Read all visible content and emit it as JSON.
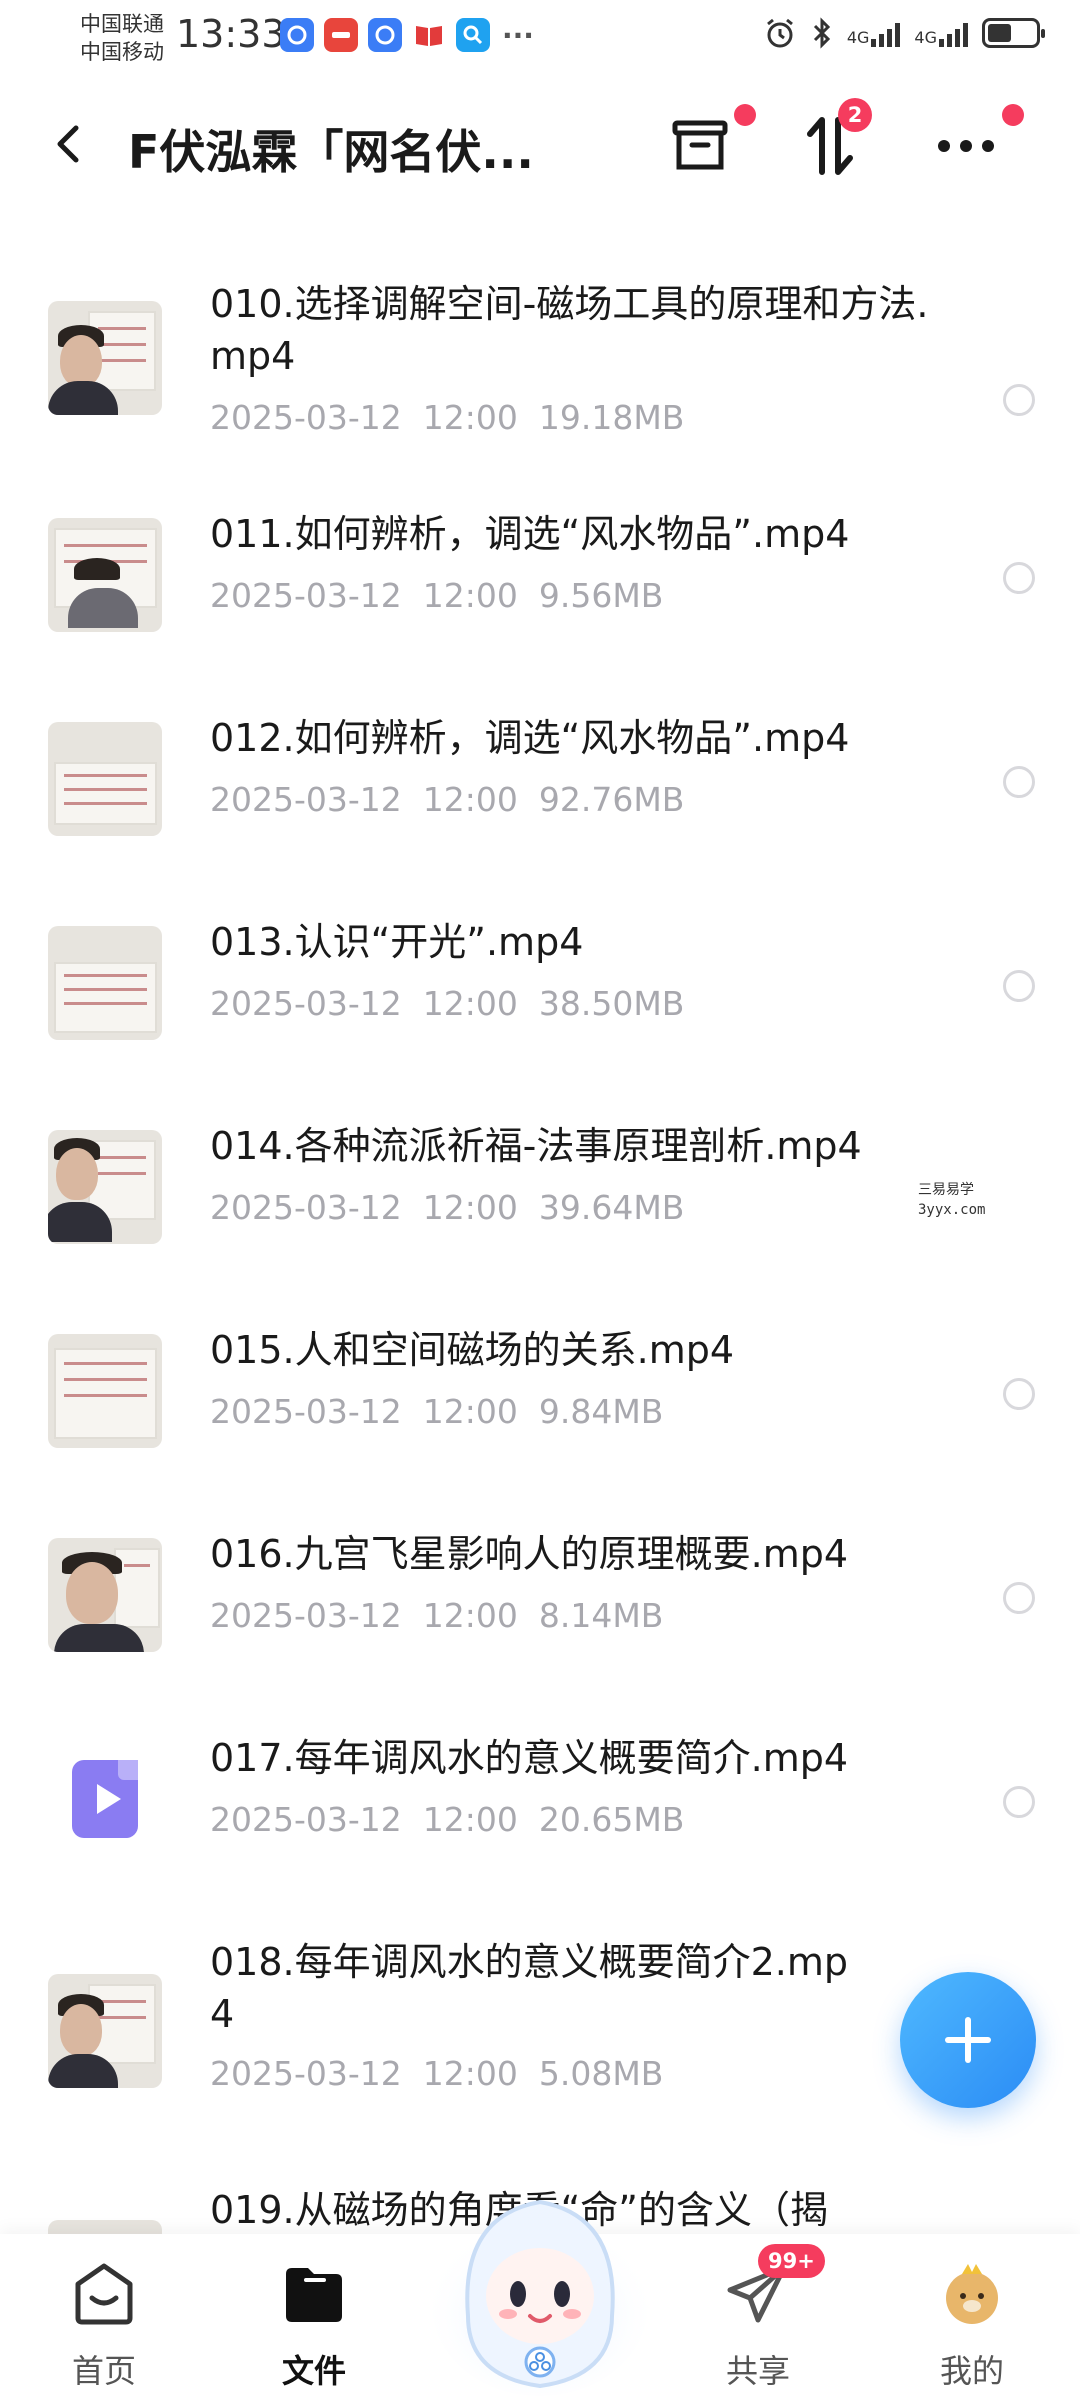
{
  "status_bar": {
    "carrier_1": "中国联通",
    "carrier_2": "中国移动",
    "time": "13:33",
    "notification_icons": [
      "baidu-netdisk-icon",
      "huawei-store-icon",
      "baidu-netdisk-icon",
      "book-reader-icon",
      "search-app-icon"
    ],
    "more_notifications": "···",
    "sim1_network": "4G",
    "sim2_network": "4G"
  },
  "header": {
    "title": "F伏泓霖「网名伏...",
    "transfer_badge": "2"
  },
  "files": [
    {
      "name": "010.选择调解空间-磁场工具的原理和方法.mp4",
      "date": "2025-03-12",
      "time": "12:00",
      "size": "19.18MB",
      "thumb": "photo"
    },
    {
      "name": "011.如何辨析，调选“风水物品”.mp4",
      "date": "2025-03-12",
      "time": "12:00",
      "size": "9.56MB",
      "thumb": "photo"
    },
    {
      "name": "012.如何辨析，调选“风水物品”.mp4",
      "date": "2025-03-12",
      "time": "12:00",
      "size": "92.76MB",
      "thumb": "photo"
    },
    {
      "name": "013.认识“开光”.mp4",
      "date": "2025-03-12",
      "time": "12:00",
      "size": "38.50MB",
      "thumb": "photo"
    },
    {
      "name": "014.各种流派祈福-法事原理剖析.mp4",
      "date": "2025-03-12",
      "time": "12:00",
      "size": "39.64MB",
      "thumb": "photo"
    },
    {
      "name": "015.人和空间磁场的关系.mp4",
      "date": "2025-03-12",
      "time": "12:00",
      "size": "9.84MB",
      "thumb": "photo"
    },
    {
      "name": "016.九宫飞星影响人的原理概要.mp4",
      "date": "2025-03-12",
      "time": "12:00",
      "size": "8.14MB",
      "thumb": "photo"
    },
    {
      "name": "017.每年调风水的意义概要简介.mp4",
      "date": "2025-03-12",
      "time": "12:00",
      "size": "20.65MB",
      "thumb": "video-icon"
    },
    {
      "name": "018.每年调风水的意义概要简介2.mp4",
      "date": "2025-03-12",
      "time": "12:00",
      "size": "5.08MB",
      "thumb": "photo"
    },
    {
      "name": "019.从磁场的角度看“命”的含义（揭",
      "date": "",
      "time": "",
      "size": "",
      "thumb": "photo"
    }
  ],
  "watermark": {
    "line1": "三易易学",
    "line2": "3yyx.com"
  },
  "bottom_nav": {
    "home": "首页",
    "files": "文件",
    "share": "共享",
    "share_badge": "99+",
    "mine": "我的"
  },
  "colors": {
    "accent_blue": "#2b8cf5",
    "badge_red": "#f53c5e",
    "meta_gray": "#a8a8ae",
    "video_icon_purple": "#8a7cf2"
  }
}
